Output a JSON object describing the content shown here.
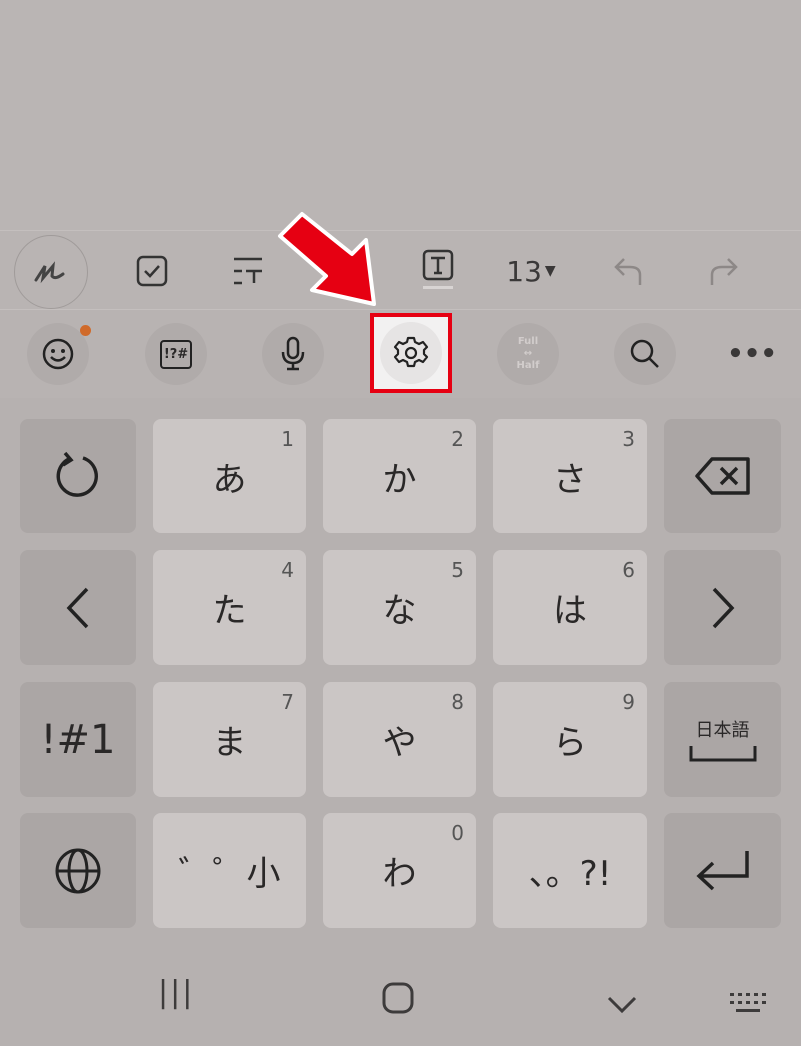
{
  "toolbar": {
    "font_size": "13",
    "icons": [
      "handwriting-icon",
      "checkbox-icon",
      "text-style-icon",
      "text-box-icon",
      "undo-icon",
      "redo-icon"
    ]
  },
  "keyboard_tools": {
    "items": [
      "emoji-icon",
      "symbols-icon",
      "microphone-icon",
      "settings-icon",
      "full-half-icon",
      "search-icon",
      "more-icon"
    ],
    "symbols_label": "!?#",
    "full_label": "Full",
    "half_label": "Half",
    "notification_color": "#d06a2a"
  },
  "highlight": {
    "color": "#e60012",
    "target": "settings"
  },
  "keys": {
    "rows": [
      [
        {
          "label": "あ",
          "num": "1"
        },
        {
          "label": "か",
          "num": "2"
        },
        {
          "label": "さ",
          "num": "3"
        }
      ],
      [
        {
          "label": "た",
          "num": "4"
        },
        {
          "label": "な",
          "num": "5"
        },
        {
          "label": "は",
          "num": "6"
        }
      ],
      [
        {
          "label": "ま",
          "num": "7"
        },
        {
          "label": "や",
          "num": "8"
        },
        {
          "label": "ら",
          "num": "9"
        }
      ],
      [
        {
          "label": "゛゜小",
          "num": ""
        },
        {
          "label": "わ",
          "num": "0"
        },
        {
          "label": "、。?!",
          "num": ""
        }
      ]
    ],
    "symbol_mode": "!#1",
    "space_label": "日本語"
  },
  "navbar": {
    "recent": "|||",
    "home": "home",
    "back": "chevron-down",
    "keyboard": "keyboard"
  }
}
